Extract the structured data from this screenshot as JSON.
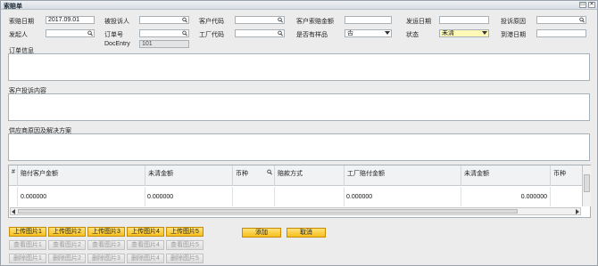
{
  "window": {
    "title": "索赔单",
    "minimize_glyph": "▭",
    "close_glyph": "✕"
  },
  "header": {
    "claim_date_label": "索赔日期",
    "claim_date_value": "2017.09.01",
    "complainant_label": "被投诉人",
    "complainant_value": "",
    "customer_code_label": "客户代码",
    "customer_code_value": "",
    "customer_claim_amount_label": "客户索赔金额",
    "customer_claim_amount_value": "",
    "ship_date_label": "发运日期",
    "ship_date_value": "",
    "complaint_reason_label": "投诉原因",
    "complaint_reason_value": "",
    "initiator_label": "发起人",
    "initiator_value": "",
    "order_no_label": "订单号",
    "order_no_value": "",
    "factory_code_label": "工厂代码",
    "factory_code_value": "",
    "has_sample_label": "是否有样品",
    "has_sample_value": "否",
    "status_label": "状态",
    "status_value": "未清",
    "arrival_date_label": "到港日期",
    "arrival_date_value": "",
    "docentry_label": "DocEntry",
    "docentry_value": "101"
  },
  "sections": {
    "order_info_label": "订单信息",
    "customer_complaint_label": "客户投诉内容",
    "supplier_reason_label": "供应商原因及解决方案"
  },
  "grid": {
    "columns": [
      "#",
      "赔付客户金额",
      "未清金额",
      "币种",
      "赔款方式",
      "工厂赔付金额",
      "未清金额",
      "币种"
    ],
    "rows": [
      [
        "",
        "0.000000",
        "0.000000",
        "",
        "",
        "0.000000",
        "0.000000",
        ""
      ]
    ]
  },
  "buttons": {
    "upload": [
      "上传图片1",
      "上传图片2",
      "上传图片3",
      "上传图片4",
      "上传图片5"
    ],
    "view": [
      "查看图片1",
      "查看图片2",
      "查看图片3",
      "查看图片4",
      "查看图片5"
    ],
    "delete": [
      "删除图片1",
      "删除图片2",
      "删除图片3",
      "删除图片4",
      "删除图片5"
    ],
    "add_label": "添加",
    "cancel_label": "取消"
  },
  "icons": {
    "lookup": "magnifier-icon",
    "dropdown": "triangle-down-icon"
  },
  "colors": {
    "button_active": "#f6bf1c",
    "status_field": "#fff9b8"
  }
}
